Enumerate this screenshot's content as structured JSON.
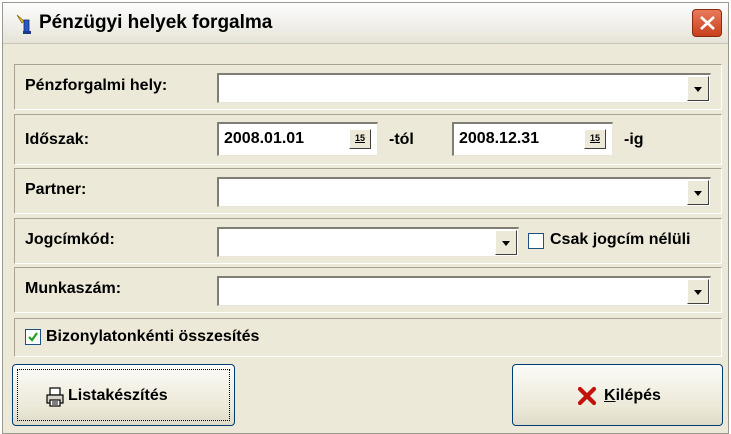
{
  "window": {
    "title": "Pénzügyi helyek forgalma"
  },
  "fields": {
    "penzforgalmi_hely": {
      "label": "Pénzforgalmi hely:",
      "value": ""
    },
    "idoszak": {
      "label": "Időszak:",
      "from_value": "2008.01.01",
      "from_suffix": "-tól",
      "to_value": "2008.12.31",
      "to_suffix": "-ig",
      "calendar_glyph": "15"
    },
    "partner": {
      "label": "Partner:",
      "value": ""
    },
    "jogcimkod": {
      "label": "Jogcímkód:",
      "value": "",
      "checkbox_label": "Csak jogcím nélüli",
      "checkbox_checked": false
    },
    "munkaszam": {
      "label": "Munkaszám:",
      "value": ""
    }
  },
  "options": {
    "bizonylatonkenti": {
      "label": "Bizonylatonkénti összesítés",
      "checked": true
    }
  },
  "buttons": {
    "listakeszites": {
      "label": "Listakészítés",
      "icon": "printer-icon"
    },
    "kilepes": {
      "label": "Kilépés",
      "accelerator": "K",
      "icon": "red-x-icon"
    }
  }
}
